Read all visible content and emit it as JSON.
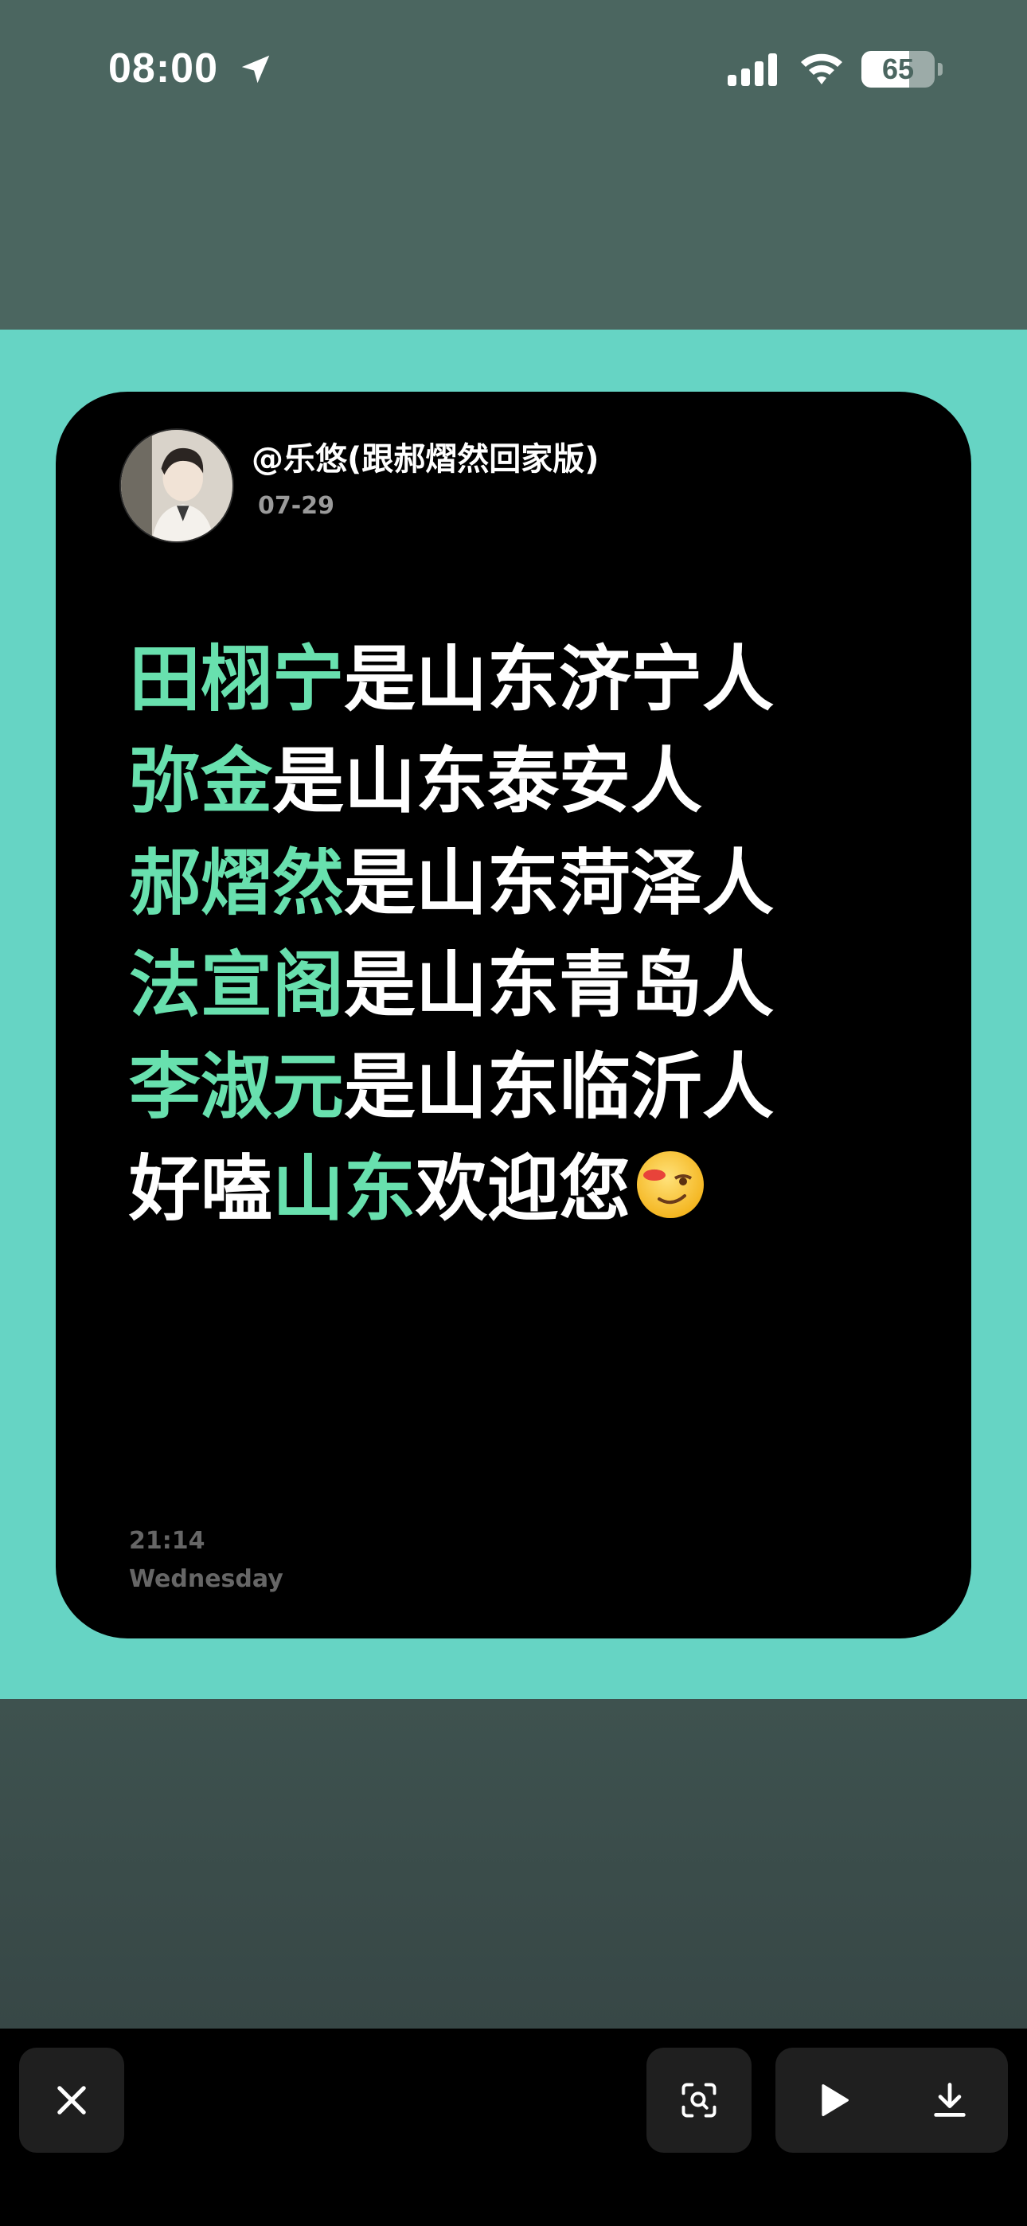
{
  "status_bar": {
    "time": "08:00",
    "battery_level": "65",
    "icons": [
      "location-arrow-icon",
      "cellular-signal-icon",
      "wifi-icon",
      "battery-icon"
    ]
  },
  "post": {
    "username": "@乐悠(跟郝熠然回家版)",
    "date": "07-29",
    "lines": [
      {
        "highlight": "田栩宁",
        "rest": "是山东济宁人"
      },
      {
        "highlight": "弥金",
        "rest": "是山东泰安人"
      },
      {
        "highlight": "郝熠然",
        "rest": "是山东菏泽人"
      },
      {
        "highlight": "法宣阁",
        "rest": "是山东青岛人"
      },
      {
        "highlight": "李淑元",
        "rest": "是山东临沂人"
      }
    ],
    "last_line": {
      "pre": "好嗑",
      "highlight": "山东",
      "post": "欢迎您",
      "emoji": "winking-face-emoji"
    },
    "time": "21:14",
    "weekday": "Wednesday"
  },
  "toolbar": {
    "icons": [
      "close-icon",
      "visual-lookup-icon",
      "play-icon",
      "download-icon"
    ]
  },
  "colors": {
    "highlight": "#68e0ae",
    "frame": "#66d4c4",
    "card": "#000000",
    "status_bg": "#4b6660"
  }
}
